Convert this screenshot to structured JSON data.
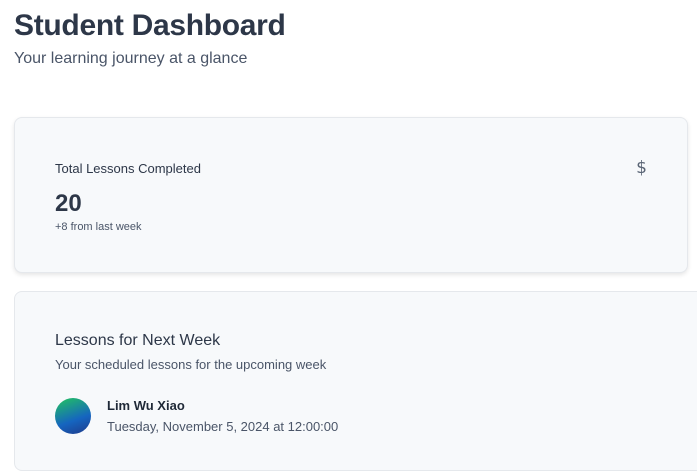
{
  "header": {
    "title": "Student Dashboard",
    "subtitle": "Your learning journey at a glance"
  },
  "stats": {
    "title": "Total Lessons Completed",
    "icon": "dollar-icon",
    "icon_glyph": "$",
    "value": "20",
    "delta": "+8 from last week"
  },
  "lessons": {
    "title": "Lessons for Next Week",
    "subtitle": "Your scheduled lessons for the upcoming week",
    "items": [
      {
        "student": "Lim Wu Xiao",
        "datetime": "Tuesday, November 5, 2024 at 12:00:00"
      }
    ]
  }
}
